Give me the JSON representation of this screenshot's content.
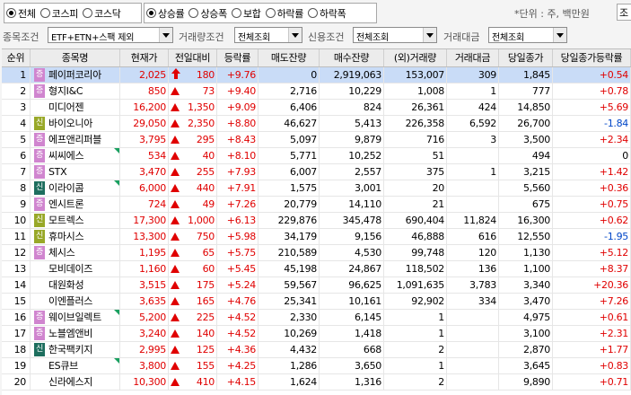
{
  "market_radios": [
    {
      "label": "전체",
      "checked": true
    },
    {
      "label": "코스피",
      "checked": false
    },
    {
      "label": "코스닥",
      "checked": false
    }
  ],
  "sort_radios": [
    {
      "label": "상승률",
      "checked": true
    },
    {
      "label": "상승폭",
      "checked": false
    },
    {
      "label": "보합",
      "checked": false
    },
    {
      "label": "하락률",
      "checked": false
    },
    {
      "label": "하락폭",
      "checked": false
    }
  ],
  "unit_text": "*단위 : 주, 백만원",
  "unit_box": "조",
  "conditions": {
    "stock_label": "종목조건",
    "stock_value": "ETF+ETN+스팩 제외",
    "volume_label": "거래량조건",
    "volume_value": "전체조회",
    "credit_label": "신용조건",
    "credit_value": "전체조회",
    "amount_label": "거래대금",
    "amount_value": "전체조회"
  },
  "columns": [
    "순위",
    "종목명",
    "현재가",
    "전일대비",
    "등락률",
    "매도잔량",
    "매수잔량",
    "(외)거래량",
    "거래대금",
    "당일종가",
    "당일종가등락률"
  ],
  "colors": {
    "up": "#e00000",
    "down": "#0046c8",
    "selected_row": "#c9dcf7",
    "badge_jeung": "#d085cf",
    "badge_sin": "#98a828",
    "badge_sin_dark": "#1d6e5e"
  },
  "rows": [
    {
      "rank": "1",
      "badge": "증",
      "name": "페이퍼코리아",
      "price": "2,025",
      "arrow": "upper",
      "change": "180",
      "rate": "+9.76",
      "sell": "0",
      "buy": "2,919,063",
      "vol": "153,007",
      "amount": "309",
      "close": "1,845",
      "close_rate": "+0.54",
      "close_dir": "up",
      "flag": false,
      "selected": true
    },
    {
      "rank": "2",
      "badge": "증",
      "name": "형지I&C",
      "price": "850",
      "arrow": "up",
      "change": "73",
      "rate": "+9.40",
      "sell": "2,716",
      "buy": "10,229",
      "vol": "1,008",
      "amount": "1",
      "close": "777",
      "close_rate": "+0.78",
      "close_dir": "up",
      "flag": false,
      "selected": false
    },
    {
      "rank": "3",
      "badge": "",
      "name": "미디어젠",
      "price": "16,200",
      "arrow": "up",
      "change": "1,350",
      "rate": "+9.09",
      "sell": "6,406",
      "buy": "824",
      "vol": "26,361",
      "amount": "424",
      "close": "14,850",
      "close_rate": "+5.69",
      "close_dir": "up",
      "flag": false,
      "selected": false
    },
    {
      "rank": "4",
      "badge": "신",
      "name": "바이오니아",
      "price": "29,050",
      "arrow": "up",
      "change": "2,350",
      "rate": "+8.80",
      "sell": "46,627",
      "buy": "5,413",
      "vol": "226,358",
      "amount": "6,592",
      "close": "26,700",
      "close_rate": "-1.84",
      "close_dir": "down",
      "flag": false,
      "selected": false
    },
    {
      "rank": "5",
      "badge": "증",
      "name": "에프앤리퍼블",
      "price": "3,795",
      "arrow": "up",
      "change": "295",
      "rate": "+8.43",
      "sell": "5,097",
      "buy": "9,879",
      "vol": "716",
      "amount": "3",
      "close": "3,500",
      "close_rate": "+2.34",
      "close_dir": "up",
      "flag": false,
      "selected": false
    },
    {
      "rank": "6",
      "badge": "증",
      "name": "씨씨에스",
      "price": "534",
      "arrow": "up",
      "change": "40",
      "rate": "+8.10",
      "sell": "5,771",
      "buy": "10,252",
      "vol": "51",
      "amount": "",
      "close": "494",
      "close_rate": "0",
      "close_dir": "none",
      "flag": true,
      "selected": false
    },
    {
      "rank": "7",
      "badge": "증",
      "name": "STX",
      "price": "3,470",
      "arrow": "up",
      "change": "255",
      "rate": "+7.93",
      "sell": "6,007",
      "buy": "2,557",
      "vol": "375",
      "amount": "1",
      "close": "3,215",
      "close_rate": "+1.42",
      "close_dir": "up",
      "flag": false,
      "selected": false
    },
    {
      "rank": "8",
      "badge": "신d",
      "name": "이라이콤",
      "price": "6,000",
      "arrow": "up",
      "change": "440",
      "rate": "+7.91",
      "sell": "1,575",
      "buy": "3,001",
      "vol": "20",
      "amount": "",
      "close": "5,560",
      "close_rate": "+0.36",
      "close_dir": "up",
      "flag": true,
      "selected": false
    },
    {
      "rank": "9",
      "badge": "증",
      "name": "엔시트론",
      "price": "724",
      "arrow": "up",
      "change": "49",
      "rate": "+7.26",
      "sell": "20,779",
      "buy": "14,110",
      "vol": "21",
      "amount": "",
      "close": "675",
      "close_rate": "+0.75",
      "close_dir": "up",
      "flag": false,
      "selected": false
    },
    {
      "rank": "10",
      "badge": "신",
      "name": "모트렉스",
      "price": "17,300",
      "arrow": "up",
      "change": "1,000",
      "rate": "+6.13",
      "sell": "229,876",
      "buy": "345,478",
      "vol": "690,404",
      "amount": "11,824",
      "close": "16,300",
      "close_rate": "+0.62",
      "close_dir": "up",
      "flag": false,
      "selected": false
    },
    {
      "rank": "11",
      "badge": "신",
      "name": "휴마시스",
      "price": "13,300",
      "arrow": "up",
      "change": "750",
      "rate": "+5.98",
      "sell": "34,179",
      "buy": "9,156",
      "vol": "46,888",
      "amount": "616",
      "close": "12,550",
      "close_rate": "-1.95",
      "close_dir": "down",
      "flag": false,
      "selected": false
    },
    {
      "rank": "12",
      "badge": "증",
      "name": "체시스",
      "price": "1,195",
      "arrow": "up",
      "change": "65",
      "rate": "+5.75",
      "sell": "210,589",
      "buy": "4,530",
      "vol": "99,748",
      "amount": "120",
      "close": "1,130",
      "close_rate": "+5.12",
      "close_dir": "up",
      "flag": false,
      "selected": false
    },
    {
      "rank": "13",
      "badge": "",
      "name": "모비데이즈",
      "price": "1,160",
      "arrow": "up",
      "change": "60",
      "rate": "+5.45",
      "sell": "45,198",
      "buy": "24,867",
      "vol": "118,502",
      "amount": "136",
      "close": "1,100",
      "close_rate": "+8.37",
      "close_dir": "up",
      "flag": false,
      "selected": false
    },
    {
      "rank": "14",
      "badge": "",
      "name": "대원화성",
      "price": "3,515",
      "arrow": "up",
      "change": "175",
      "rate": "+5.24",
      "sell": "59,567",
      "buy": "96,625",
      "vol": "1,091,635",
      "amount": "3,783",
      "close": "3,340",
      "close_rate": "+20.36",
      "close_dir": "up",
      "flag": false,
      "selected": false
    },
    {
      "rank": "15",
      "badge": "",
      "name": "이엔플러스",
      "price": "3,635",
      "arrow": "up",
      "change": "165",
      "rate": "+4.76",
      "sell": "25,341",
      "buy": "10,161",
      "vol": "92,902",
      "amount": "334",
      "close": "3,470",
      "close_rate": "+7.26",
      "close_dir": "up",
      "flag": false,
      "selected": false
    },
    {
      "rank": "16",
      "badge": "증",
      "name": "웨이브일렉트",
      "price": "5,200",
      "arrow": "up",
      "change": "225",
      "rate": "+4.52",
      "sell": "2,330",
      "buy": "6,145",
      "vol": "1",
      "amount": "",
      "close": "4,975",
      "close_rate": "+0.61",
      "close_dir": "up",
      "flag": true,
      "selected": false
    },
    {
      "rank": "17",
      "badge": "증",
      "name": "노블엠앤비",
      "price": "3,240",
      "arrow": "up",
      "change": "140",
      "rate": "+4.52",
      "sell": "10,269",
      "buy": "1,418",
      "vol": "1",
      "amount": "",
      "close": "3,100",
      "close_rate": "+2.31",
      "close_dir": "up",
      "flag": false,
      "selected": false
    },
    {
      "rank": "18",
      "badge": "신d",
      "name": "한국팩키지",
      "price": "2,995",
      "arrow": "up",
      "change": "125",
      "rate": "+4.36",
      "sell": "4,432",
      "buy": "668",
      "vol": "2",
      "amount": "",
      "close": "2,870",
      "close_rate": "+1.77",
      "close_dir": "up",
      "flag": false,
      "selected": false
    },
    {
      "rank": "19",
      "badge": "",
      "name": "ES큐브",
      "price": "3,800",
      "arrow": "up",
      "change": "155",
      "rate": "+4.25",
      "sell": "1,286",
      "buy": "3,650",
      "vol": "1",
      "amount": "",
      "close": "3,645",
      "close_rate": "+0.83",
      "close_dir": "up",
      "flag": true,
      "selected": false
    },
    {
      "rank": "20",
      "badge": "",
      "name": "신라에스지",
      "price": "10,300",
      "arrow": "up",
      "change": "410",
      "rate": "+4.15",
      "sell": "1,624",
      "buy": "1,316",
      "vol": "2",
      "amount": "",
      "close": "9,890",
      "close_rate": "+0.71",
      "close_dir": "up",
      "flag": false,
      "selected": false
    }
  ]
}
